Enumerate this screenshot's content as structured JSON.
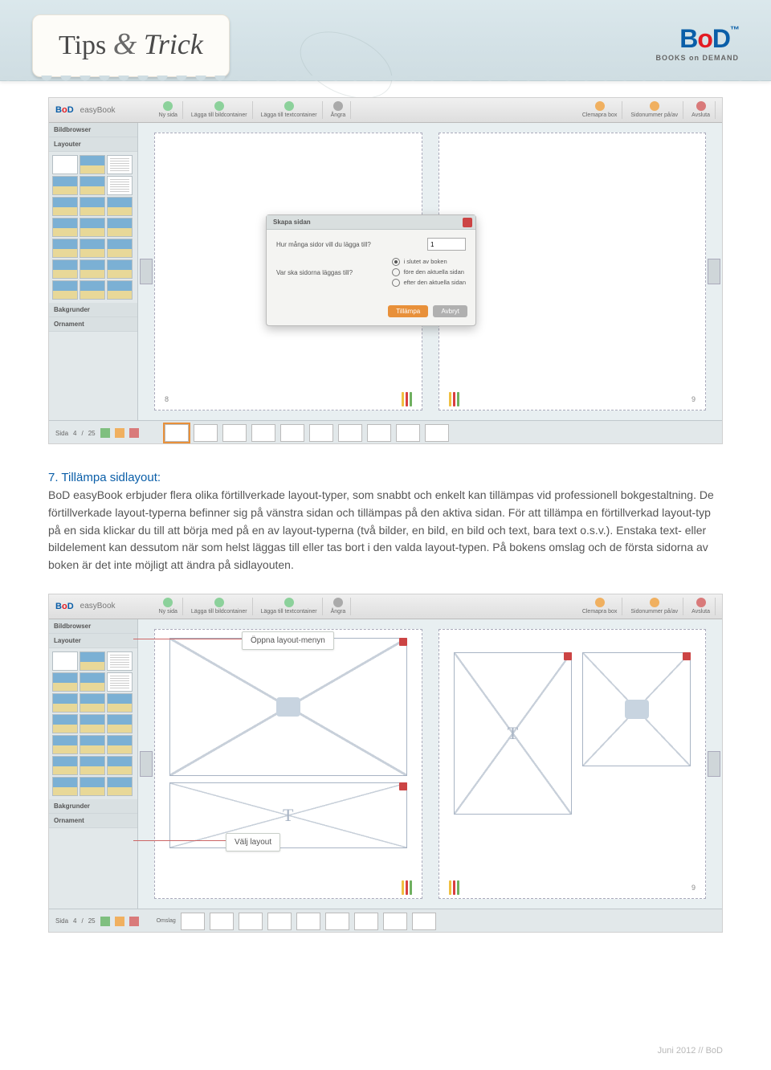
{
  "header": {
    "tips_word": "Tips",
    "amp": "&",
    "trick_word": "Trick",
    "logo_main": "BoD",
    "logo_sub": "BOOKS on DEMAND"
  },
  "screenshot1": {
    "brand": "BoD",
    "appname": "easyBook",
    "toolbar": [
      "Ny sida",
      "Lägga till bildcontainer",
      "Lägga till textcontainer",
      "Ångra",
      "Clemapra box",
      "Sidonummer på/av",
      "Avsluta"
    ],
    "sidebar_sections": [
      "Bildbrowser",
      "Layouter",
      "Bakgrunder",
      "Ornament"
    ],
    "modal": {
      "title": "Skapa sidan",
      "q1": "Hur många sidor vill du lägga till?",
      "q1_value": "1",
      "q2": "Var ska sidorna läggas till?",
      "opts": [
        "i slutet av boken",
        "före den aktuella sidan",
        "efter den aktuella sidan"
      ],
      "btn_primary": "Tillämpa",
      "btn_secondary": "Avbryt"
    },
    "filmstrip_label": "Sida",
    "filmstrip_page": "4",
    "filmstrip_total": "25",
    "left_page_num": "8",
    "right_page_num": "9",
    "bottom_label": "Omslag"
  },
  "article": {
    "heading": "7. Tillämpa sidlayout:",
    "body": "BoD easyBook erbjuder flera olika förtillverkade layout-typer, som snabbt och enkelt kan tillämpas vid professionell bokgestaltning. De förtillverkade layout-typerna befinner sig på vänstra sidan och tillämpas på den aktiva sidan. För att tillämpa en förtillverkad layout-typ på en sida klickar du till att börja med på en av layout-typerna (två bilder, en bild, en bild och text, bara text o.s.v.). Enstaka text- eller bildelement kan dessutom när som helst läggas till eller tas bort i den valda layout-typen. På bokens omslag och de första sidorna av boken är det inte möjligt att ändra på sidlayouten."
  },
  "screenshot2": {
    "callout1": "Öppna layout-menyn",
    "callout2": "Välj layout",
    "right_page_num": "9"
  },
  "footer": "Juni 2012  //  BoD"
}
